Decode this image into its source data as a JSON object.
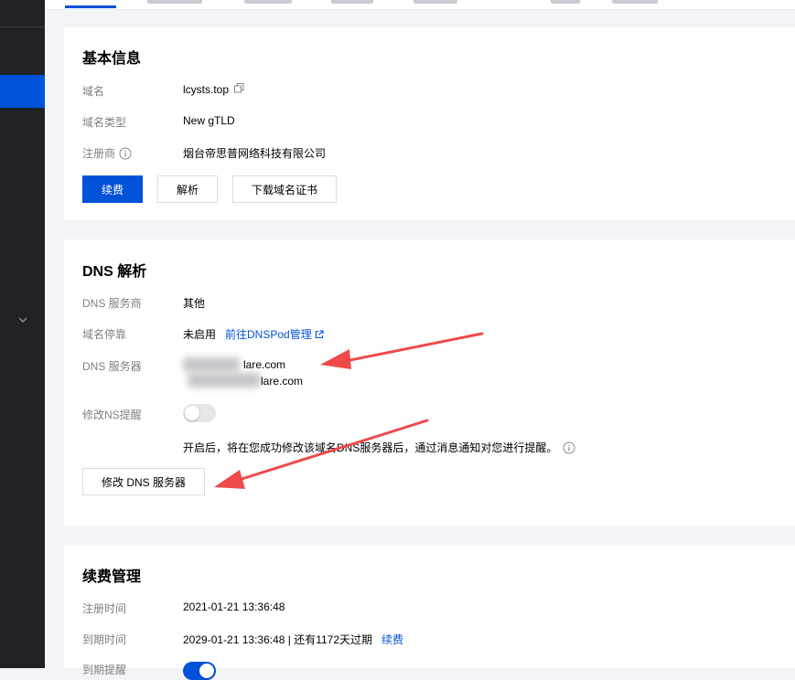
{
  "colors": {
    "primary": "#0052d9",
    "sidebar": "#202124",
    "annotation_arrow": "#ef4a4a"
  },
  "basic_info": {
    "title": "基本信息",
    "domain_label": "域名",
    "domain_value": "lcysts.top",
    "type_label": "域名类型",
    "type_value": "New gTLD",
    "registrar_label": "注册商",
    "registrar_value": "烟台帝思普网络科技有限公司",
    "renew_button": "续费",
    "resolve_button": "解析",
    "download_cert_button": "下载域名证书"
  },
  "dns": {
    "title": "DNS 解析",
    "provider_label": "DNS 服务商",
    "provider_value": "其他",
    "parking_label": "域名停靠",
    "parking_status": "未启用",
    "parking_link": "前往DNSPod管理",
    "server_label": "DNS 服务器",
    "server_1": "lare.com",
    "server_2": "lare.com",
    "ns_remind_label": "修改NS提醒",
    "ns_remind_on": false,
    "ns_remind_hint": "开启后，将在您成功修改该域名DNS服务器后，通过消息通知对您进行提醒。",
    "modify_button": "修改 DNS 服务器"
  },
  "renewal": {
    "title": "续费管理",
    "reg_time_label": "注册时间",
    "reg_time_value": "2021-01-21 13:36:48",
    "expire_label": "到期时间",
    "expire_value": "2029-01-21 13:36:48 | 还有1172天过期",
    "renew_link": "续费",
    "expire_remind_label": "到期提醒",
    "expire_remind_on": true
  }
}
